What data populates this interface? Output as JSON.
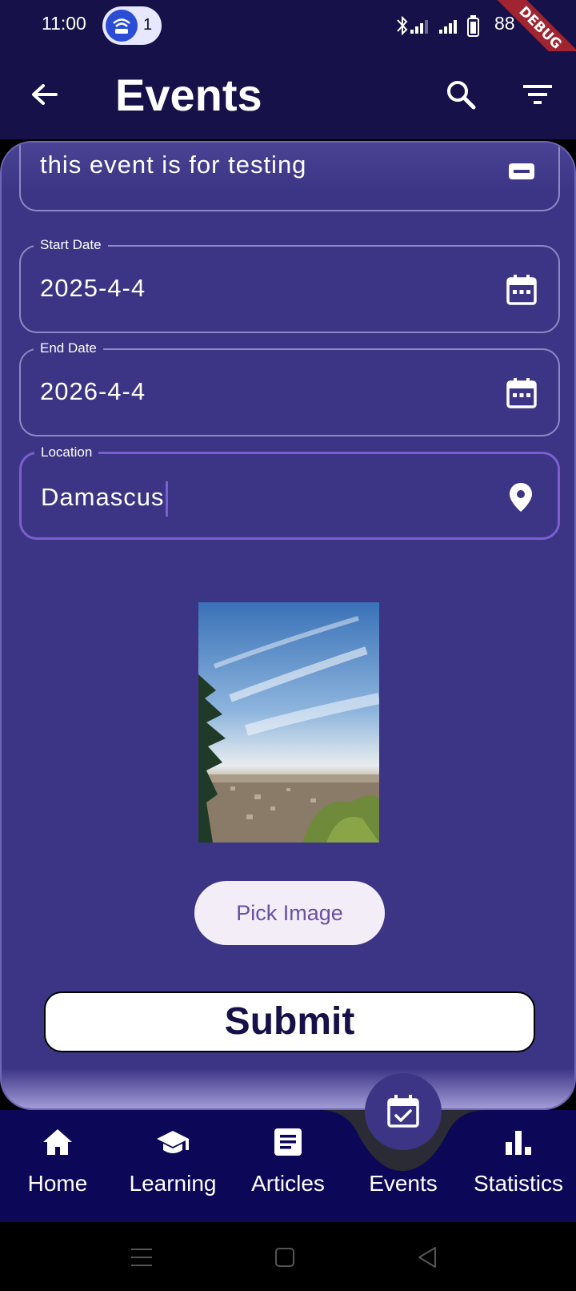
{
  "status_bar": {
    "time": "11:00",
    "hotspot_count": "1",
    "battery": "88",
    "debug_label": "DEBUG",
    "icons": [
      "wifi-hotspot-icon",
      "bluetooth-icon",
      "signal-icon",
      "signal-icon",
      "battery-icon"
    ]
  },
  "app_bar": {
    "title": "Events",
    "back_icon": "arrow-back-icon",
    "search_icon": "search-icon",
    "filter_icon": "filter-icon"
  },
  "form": {
    "description_value": "this event is for testing",
    "start_date": {
      "label": "Start Date",
      "value": "2025-4-4"
    },
    "end_date": {
      "label": "End Date",
      "value": "2026-4-4"
    },
    "location": {
      "label": "Location",
      "value": "Damascus"
    },
    "pick_image_label": "Pick Image",
    "submit_label": "Submit"
  },
  "bottom_nav": {
    "items": [
      {
        "label": "Home",
        "icon": "home-icon"
      },
      {
        "label": "Learning",
        "icon": "school-icon"
      },
      {
        "label": "Articles",
        "icon": "article-icon"
      },
      {
        "label": "Events",
        "icon": "event-check-icon",
        "selected": true
      },
      {
        "label": "Statistics",
        "icon": "bar-chart-icon"
      }
    ]
  },
  "colors": {
    "app_bar_bg": "#161249",
    "card_bg": "#3c3585",
    "nav_bg": "#0c0757",
    "submit_text": "#161249",
    "pick_image_text": "#6a4fa3",
    "focus_border": "#7a5fd1"
  }
}
